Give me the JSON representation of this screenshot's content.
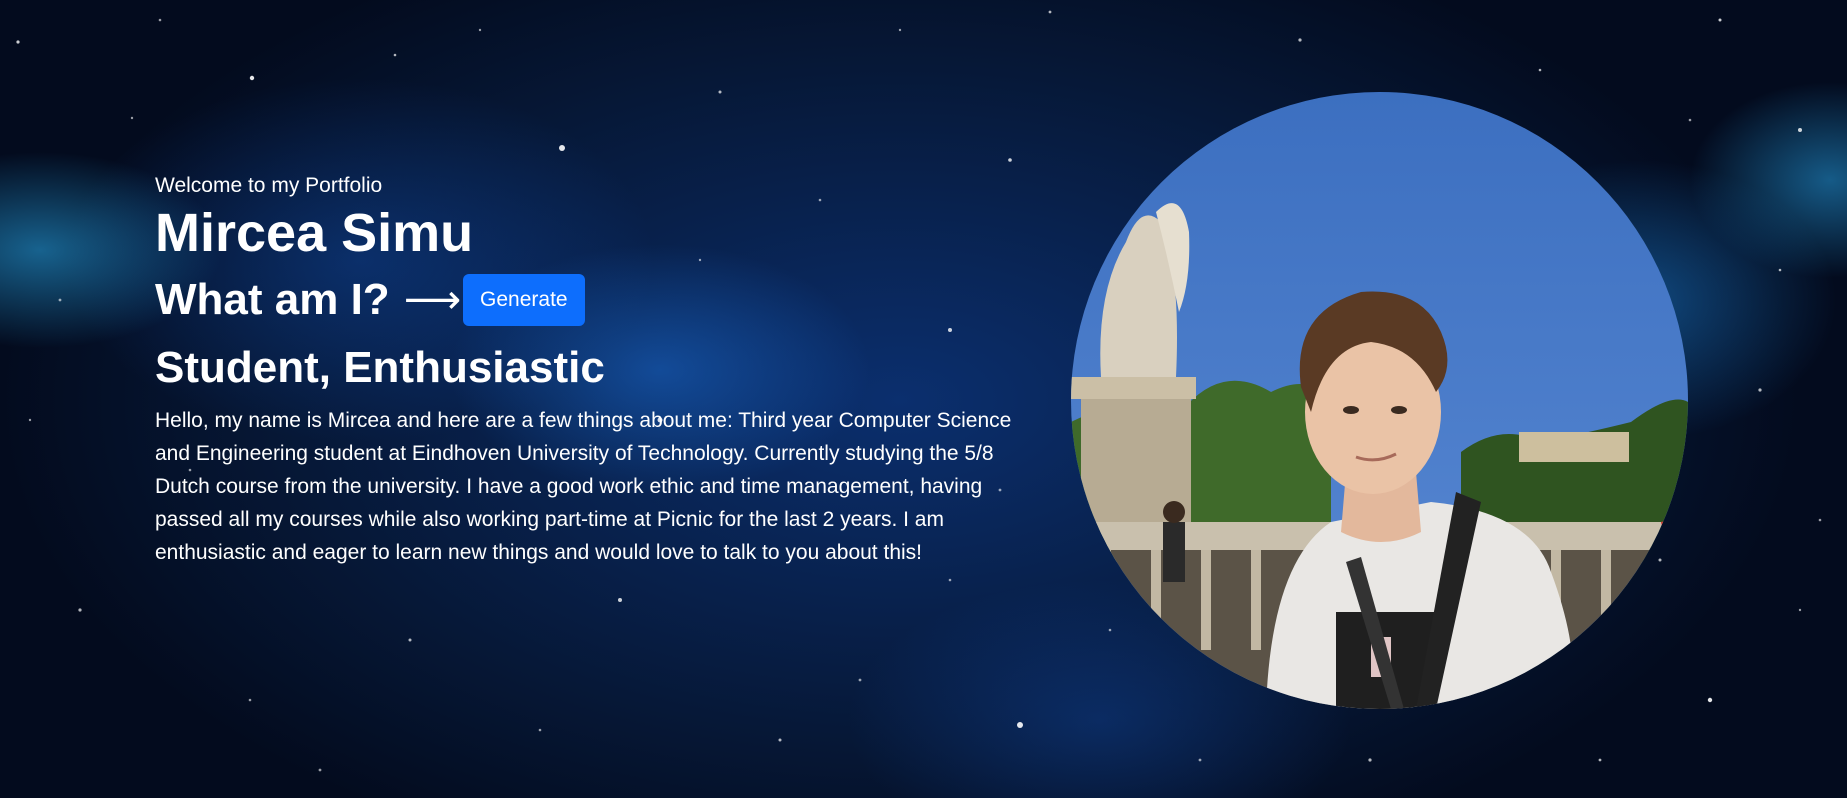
{
  "hero": {
    "welcome": "Welcome to my Portfolio",
    "name": "Mircea Simu",
    "question": "What am I?",
    "arrow_icon": "right-arrow-icon",
    "generate_label": "Generate",
    "role": "Student, Enthusiastic",
    "bio": "Hello, my name is Mircea and here are a few things about me: Third year Computer Science and Engineering student at Eindhoven University of Technology. Currently studying the 5/8 Dutch course from the university. I have a good work ethic and time management, having passed all my courses while also working part-time at Picnic for the last 2 years. I am enthusiastic and eager to learn new things and would love to talk to you about this!"
  },
  "colors": {
    "button": "#0d6efd",
    "background": "#061735",
    "text": "#ffffff"
  }
}
